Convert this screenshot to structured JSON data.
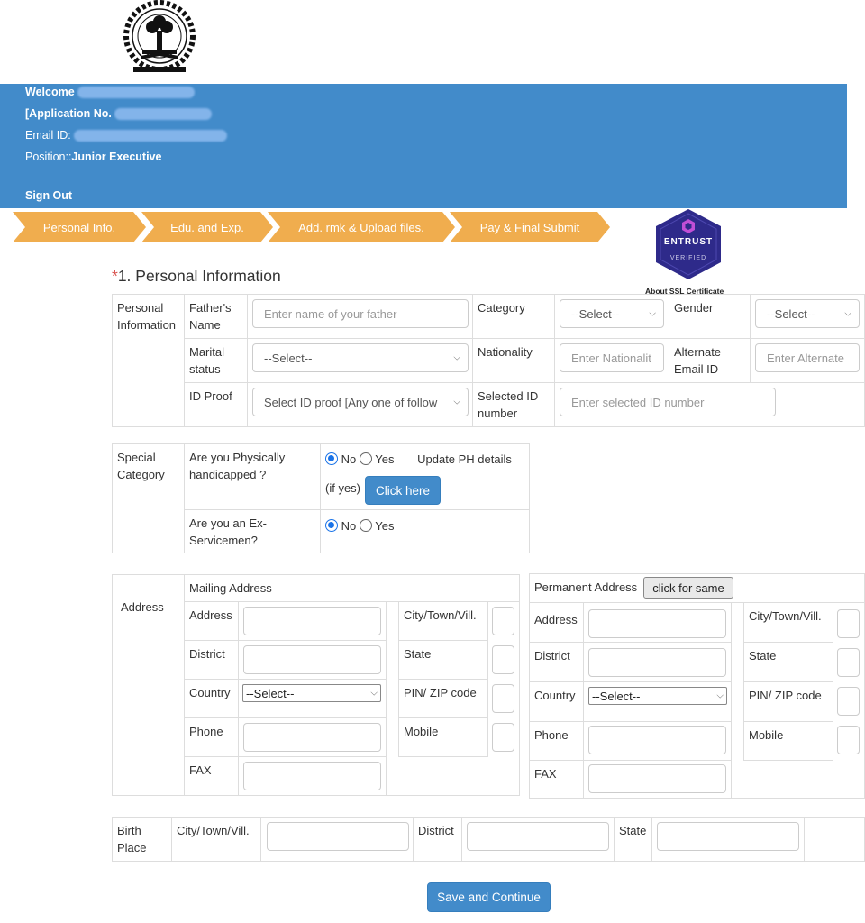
{
  "header": {
    "welcome_label": "Welcome",
    "application_label": "[Application No.",
    "email_label": "Email ID:",
    "position_label": "Position::",
    "position_value": "Junior Executive",
    "sign_out": "Sign Out"
  },
  "steps": [
    {
      "label": "Personal Info."
    },
    {
      "label": "Edu. and Exp."
    },
    {
      "label": "Add. rmk & Upload files."
    },
    {
      "label": "Pay & Final Submit"
    }
  ],
  "badge": {
    "brand": "ENTRUST",
    "sub": "VERIFIED",
    "link": "About SSL Certificate"
  },
  "section": {
    "required_mark": "*",
    "title": "1. Personal Information"
  },
  "personal": {
    "group_label": "Personal Information",
    "father_label": "Father's Name",
    "father_placeholder": "Enter name of your father",
    "category_label": "Category",
    "category_value": "--Select--",
    "gender_label": "Gender",
    "gender_value": "--Select--",
    "marital_label": "Marital status",
    "marital_value": "--Select--",
    "nationality_label": "Nationality",
    "nationality_placeholder": "Enter Nationalit",
    "alt_email_label": "Alternate Email ID",
    "alt_email_placeholder": "Enter Alternate",
    "id_proof_label": "ID Proof",
    "id_proof_value": "Select ID proof [Any one of follow",
    "selected_id_label": "Selected ID number",
    "selected_id_placeholder": "Enter selected ID number"
  },
  "special": {
    "group_label": "Special Category",
    "ph_question": "Are you Physically handicapped ?",
    "no_label": "No",
    "yes_label": "Yes",
    "update_ph": "Update PH details",
    "if_yes": "(if yes)",
    "click_here": "Click here",
    "ex_question": "Are you an Ex-Servicemen?"
  },
  "address": {
    "group_label": "Address",
    "mailing_title": "Mailing Address",
    "permanent_title": "Permanent Address",
    "same_button": "click for same",
    "address_label": "Address",
    "city_label": "City/Town/Vill.",
    "district_label": "District",
    "state_label": "State",
    "country_label": "Country",
    "country_value": "--Select--",
    "pin_label": "PIN/ ZIP code",
    "phone_label": "Phone",
    "mobile_label": "Mobile",
    "fax_label": "FAX"
  },
  "birth": {
    "group_label": "Birth Place",
    "city_label": "City/Town/Vill.",
    "district_label": "District",
    "state_label": "State"
  },
  "save_button": "Save and Continue",
  "colors": {
    "banner": "#428bca",
    "step": "#f0ad4e",
    "button": "#428bca",
    "required": "#d9534f"
  }
}
